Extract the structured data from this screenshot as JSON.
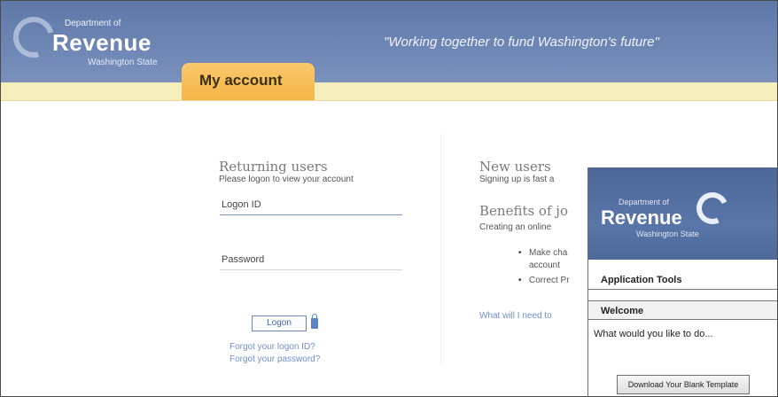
{
  "header": {
    "logo_dept": "Department of",
    "logo_name": "Revenue",
    "logo_state": "Washington State",
    "tagline": "\"Working together to fund Washington's future\"",
    "tab_label": "My account"
  },
  "returning": {
    "title": "Returning users",
    "subtitle": "Please logon to view your account",
    "logon_id_label": "Logon ID",
    "password_label": "Password",
    "logon_button": "Logon",
    "forgot_id": "Forgot your logon ID?",
    "forgot_password": "Forgot your password?"
  },
  "new_users": {
    "title": "New users",
    "subtitle": "Signing up is fast a",
    "benefits_title": "Benefits of jo",
    "benefits_sub": "Creating an online",
    "bullets": [
      "Make cha",
      "account",
      "Correct Pr"
    ],
    "what_link": "What will I need to"
  },
  "app_window": {
    "logo_dept": "Department of",
    "logo_name": "Revenue",
    "logo_state": "Washington State",
    "tools_label": "Application Tools",
    "welcome_label": "Welcome",
    "question": "What would you like to do...",
    "download_button": "Download Your Blank Template"
  }
}
